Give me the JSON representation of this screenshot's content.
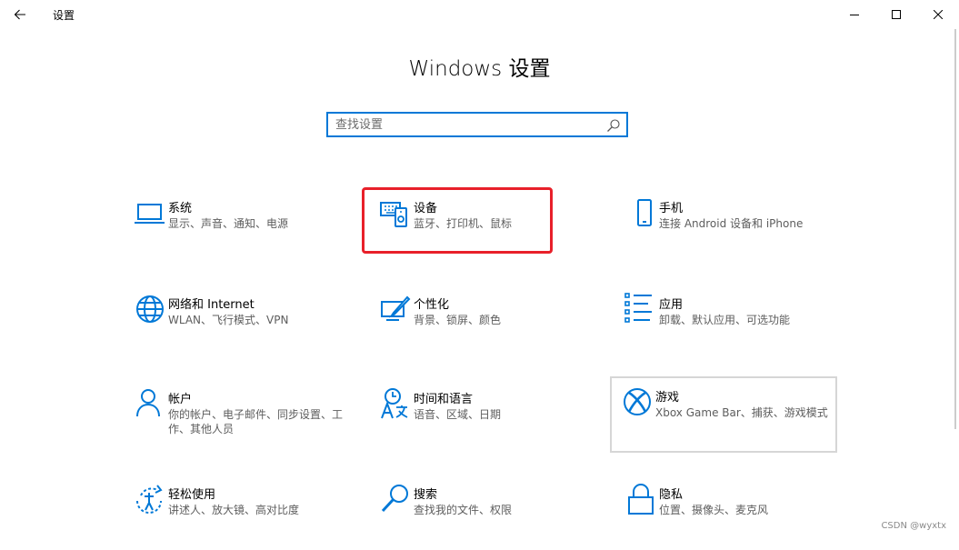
{
  "window": {
    "title": "设置",
    "controls": {
      "minimize": "minimize-icon",
      "maximize": "maximize-icon",
      "close": "close-icon"
    }
  },
  "page": {
    "heading": "Windows 设置"
  },
  "search": {
    "placeholder": "查找设置",
    "value": ""
  },
  "tiles": [
    {
      "name": "系统",
      "desc": "显示、声音、通知、电源",
      "icon": "laptop-icon"
    },
    {
      "name": "设备",
      "desc": "蓝牙、打印机、鼠标",
      "icon": "devices-icon"
    },
    {
      "name": "手机",
      "desc": "连接 Android 设备和 iPhone",
      "icon": "phone-icon"
    },
    {
      "name": "网络和 Internet",
      "desc": "WLAN、飞行模式、VPN",
      "icon": "globe-icon"
    },
    {
      "name": "个性化",
      "desc": "背景、锁屏、颜色",
      "icon": "personalization-icon"
    },
    {
      "name": "应用",
      "desc": "卸载、默认应用、可选功能",
      "icon": "apps-list-icon"
    },
    {
      "name": "帐户",
      "desc": "你的帐户、电子邮件、同步设置、工作、其他人员",
      "icon": "person-icon"
    },
    {
      "name": "时间和语言",
      "desc": "语音、区域、日期",
      "icon": "time-language-icon"
    },
    {
      "name": "游戏",
      "desc": "Xbox Game Bar、捕获、游戏模式",
      "icon": "xbox-icon"
    },
    {
      "name": "轻松使用",
      "desc": "讲述人、放大镜、高对比度",
      "icon": "ease-of-access-icon"
    },
    {
      "name": "搜索",
      "desc": "查找我的文件、权限",
      "icon": "search-icon"
    },
    {
      "name": "隐私",
      "desc": "位置、摄像头、麦克风",
      "icon": "lock-icon"
    }
  ],
  "watermark": "CSDN @wyxtx",
  "colors": {
    "accent": "#0078d7",
    "highlight": "#e8202a",
    "hover_border": "#d6d6d6",
    "desc_text": "#5d5d5d"
  }
}
